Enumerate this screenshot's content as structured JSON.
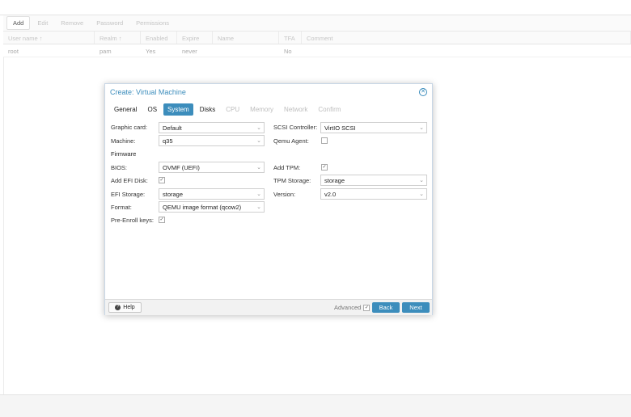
{
  "toolbar": {
    "add": "Add",
    "edit": "Edit",
    "remove": "Remove",
    "password": "Password",
    "permissions": "Permissions"
  },
  "grid": {
    "columns": [
      "User name ↑",
      "Realm ↑",
      "Enabled",
      "Expire",
      "Name",
      "TFA",
      "Comment"
    ],
    "rows": [
      {
        "user": "root",
        "realm": "pam",
        "enabled": "Yes",
        "expire": "never",
        "name": "",
        "tfa": "No",
        "comment": ""
      }
    ]
  },
  "dialog": {
    "title": "Create: Virtual Machine",
    "tabs": [
      {
        "label": "General",
        "state": "normal"
      },
      {
        "label": "OS",
        "state": "normal"
      },
      {
        "label": "System",
        "state": "selected"
      },
      {
        "label": "Disks",
        "state": "normal"
      },
      {
        "label": "CPU",
        "state": "disabled"
      },
      {
        "label": "Memory",
        "state": "disabled"
      },
      {
        "label": "Network",
        "state": "disabled"
      },
      {
        "label": "Confirm",
        "state": "disabled"
      }
    ],
    "left": {
      "graphic_card_label": "Graphic card:",
      "graphic_card_value": "Default",
      "machine_label": "Machine:",
      "machine_value": "q35",
      "firmware_header": "Firmware",
      "bios_label": "BIOS:",
      "bios_value": "OVMF (UEFI)",
      "add_efi_label": "Add EFI Disk:",
      "add_efi_checked": true,
      "efi_storage_label": "EFI Storage:",
      "efi_storage_value": "storage",
      "format_label": "Format:",
      "format_value": "QEMU image format (qcow2)",
      "pre_enroll_label": "Pre-Enroll keys:",
      "pre_enroll_checked": true
    },
    "right": {
      "scsi_label": "SCSI Controller:",
      "scsi_value": "VirtIO SCSI",
      "qemu_agent_label": "Qemu Agent:",
      "qemu_agent_checked": false,
      "add_tpm_label": "Add TPM:",
      "add_tpm_checked": true,
      "tpm_storage_label": "TPM Storage:",
      "tpm_storage_value": "storage",
      "version_label": "Version:",
      "version_value": "v2.0"
    },
    "footer": {
      "help": "Help",
      "advanced": "Advanced",
      "advanced_checked": true,
      "back": "Back",
      "next": "Next"
    },
    "accent_color": "#3c8dbc"
  }
}
